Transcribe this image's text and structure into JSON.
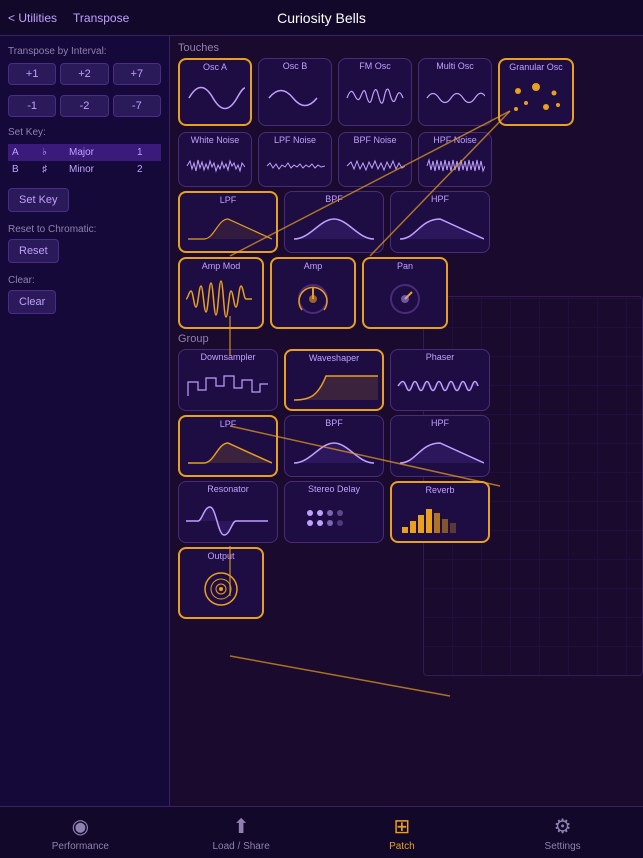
{
  "app": {
    "title": "Curiosity Bells",
    "nav_back": "< Utilities",
    "nav_transpose": "Transpose"
  },
  "sidebar": {
    "transpose_label": "Transpose by Interval:",
    "intervals_pos": [
      "+1",
      "+2",
      "+7"
    ],
    "intervals_neg": [
      "-1",
      "-2",
      "-7"
    ],
    "set_key_label": "Set Key:",
    "keys": [
      {
        "note": "A",
        "sharp": "♭",
        "scale": "Major",
        "num": "1"
      },
      {
        "note": "B",
        "sharp": "♯",
        "scale": "Minor",
        "num": "2"
      }
    ],
    "set_key_btn": "Set Key",
    "reset_label": "Reset to Chromatic:",
    "reset_btn": "Reset",
    "clear_label": "Clear:",
    "clear_btn": "Clear"
  },
  "touches": {
    "label": "Touches",
    "nodes": [
      {
        "id": "osc-a",
        "label": "Osc A",
        "selected": true,
        "type": "sine"
      },
      {
        "id": "osc-b",
        "label": "Osc B",
        "selected": false,
        "type": "sine_small"
      },
      {
        "id": "fm-osc",
        "label": "FM Osc",
        "selected": false,
        "type": "multi"
      },
      {
        "id": "multi-osc",
        "label": "Multi Osc",
        "selected": false,
        "type": "multi2"
      },
      {
        "id": "granular-osc",
        "label": "Granular Osc",
        "selected": true,
        "type": "granular"
      }
    ],
    "noise_nodes": [
      {
        "id": "white-noise",
        "label": "White Noise",
        "type": "noise1"
      },
      {
        "id": "lpf-noise",
        "label": "LPF Noise",
        "type": "noise2"
      },
      {
        "id": "bpf-noise",
        "label": "BPF Noise",
        "type": "noise3"
      },
      {
        "id": "hpf-noise",
        "label": "HPF Noise",
        "type": "noise4"
      }
    ]
  },
  "filters": {
    "nodes": [
      {
        "id": "lpf",
        "label": "LPF",
        "selected": true,
        "type": "lpf"
      },
      {
        "id": "bpf",
        "label": "BPF",
        "selected": false,
        "type": "bpf"
      },
      {
        "id": "hpf",
        "label": "HPF",
        "selected": false,
        "type": "hpf"
      }
    ]
  },
  "amp_row": {
    "nodes": [
      {
        "id": "amp-mod",
        "label": "Amp Mod",
        "selected": true,
        "type": "amp_mod"
      },
      {
        "id": "amp",
        "label": "Amp",
        "selected": true,
        "type": "amp"
      },
      {
        "id": "pan",
        "label": "Pan",
        "selected": true,
        "type": "pan"
      }
    ]
  },
  "group": {
    "label": "Group",
    "nodes": [
      {
        "id": "downsampler",
        "label": "Downsampler",
        "type": "downsampler"
      },
      {
        "id": "waveshaper",
        "label": "Waveshaper",
        "selected": true,
        "type": "waveshaper"
      },
      {
        "id": "phaser",
        "label": "Phaser",
        "type": "phaser"
      }
    ]
  },
  "group_filters": {
    "nodes": [
      {
        "id": "g-lpf",
        "label": "LPF",
        "selected": true,
        "type": "lpf"
      },
      {
        "id": "g-bpf",
        "label": "BPF",
        "selected": false,
        "type": "bpf"
      },
      {
        "id": "g-hpf",
        "label": "HPF",
        "selected": false,
        "type": "hpf"
      }
    ]
  },
  "effects": {
    "nodes": [
      {
        "id": "resonator",
        "label": "Resonator",
        "type": "resonator"
      },
      {
        "id": "stereo-delay",
        "label": "Stereo Delay",
        "type": "stereo_delay"
      },
      {
        "id": "reverb",
        "label": "Reverb",
        "selected": true,
        "type": "reverb"
      }
    ]
  },
  "output": {
    "id": "output",
    "label": "Output",
    "type": "output"
  },
  "bottom_nav": {
    "items": [
      {
        "id": "performance",
        "label": "Performance",
        "icon": "◎",
        "active": false
      },
      {
        "id": "load-share",
        "label": "Load / Share",
        "icon": "⬆",
        "active": false
      },
      {
        "id": "patch",
        "label": "Patch",
        "icon": "⊞",
        "active": true
      },
      {
        "id": "settings",
        "label": "Settings",
        "icon": "⚙",
        "active": false
      }
    ]
  }
}
